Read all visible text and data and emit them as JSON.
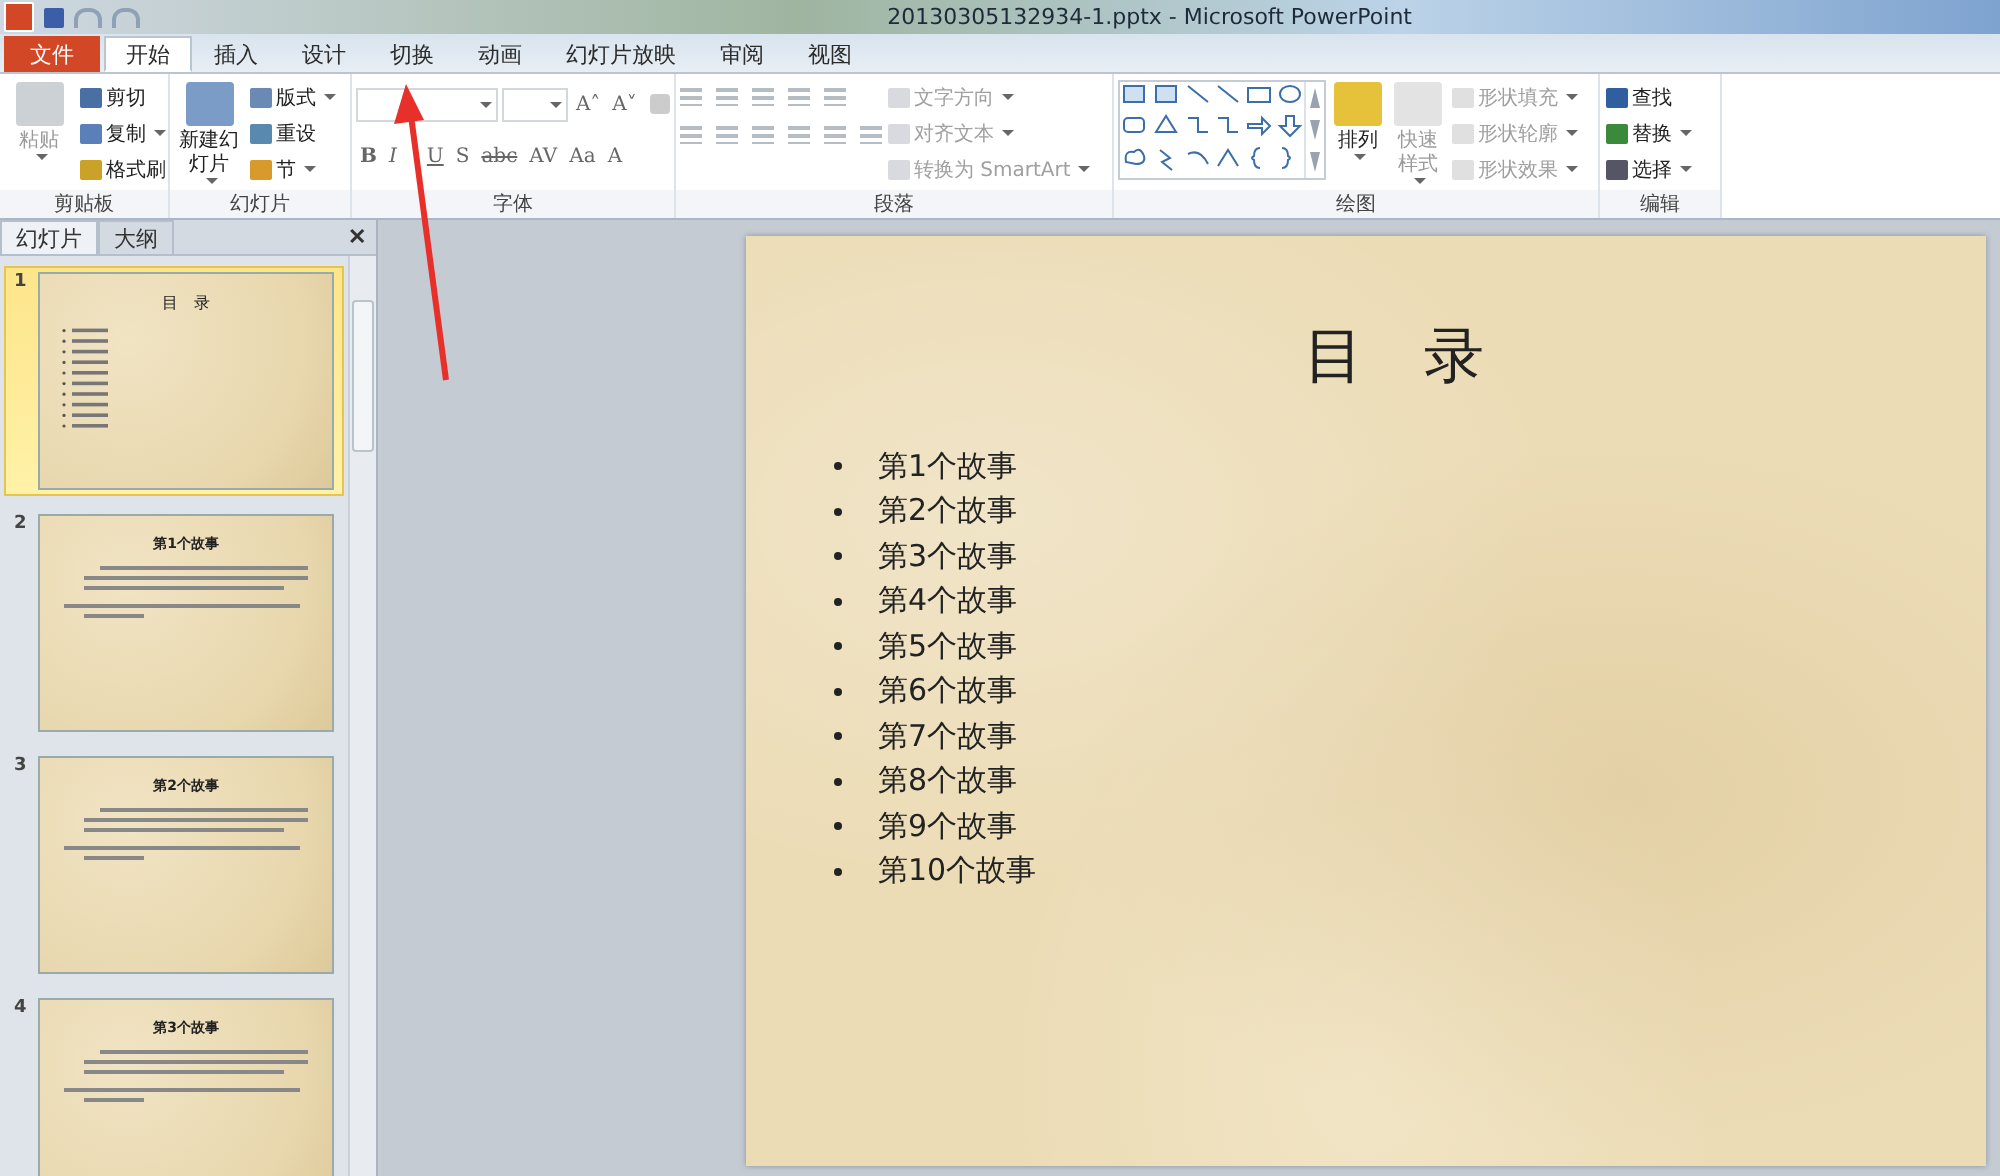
{
  "window": {
    "title": "20130305132934-1.pptx - Microsoft PowerPoint"
  },
  "tabs": [
    {
      "label": "文件",
      "kind": "file",
      "selected": false
    },
    {
      "label": "开始",
      "kind": "tab",
      "selected": true
    },
    {
      "label": "插入",
      "kind": "tab",
      "selected": false
    },
    {
      "label": "设计",
      "kind": "tab",
      "selected": false
    },
    {
      "label": "切换",
      "kind": "tab",
      "selected": false
    },
    {
      "label": "动画",
      "kind": "tab",
      "selected": false
    },
    {
      "label": "幻灯片放映",
      "kind": "tab",
      "selected": false
    },
    {
      "label": "审阅",
      "kind": "tab",
      "selected": false
    },
    {
      "label": "视图",
      "kind": "tab",
      "selected": false
    }
  ],
  "ribbon": [
    {
      "name": "剪贴板",
      "kind": "buttons",
      "items": [
        {
          "label": "粘贴",
          "kind": "large",
          "disabled": true,
          "dropdown": true
        },
        {
          "label": "剪切",
          "kind": "small",
          "disabled": false,
          "dropdown": false
        },
        {
          "label": "复制",
          "kind": "small",
          "disabled": false,
          "dropdown": true
        },
        {
          "label": "格式刷",
          "kind": "small",
          "disabled": false,
          "dropdown": false
        }
      ]
    },
    {
      "name": "幻灯片",
      "kind": "buttons",
      "items": [
        {
          "label": "新建幻灯片",
          "kind": "large",
          "disabled": false,
          "dropdown": true
        },
        {
          "label": "版式",
          "kind": "small",
          "disabled": false,
          "dropdown": true
        },
        {
          "label": "重设",
          "kind": "small",
          "disabled": false,
          "dropdown": false
        },
        {
          "label": "节",
          "kind": "small",
          "disabled": false,
          "dropdown": true
        }
      ]
    },
    {
      "name": "字体",
      "kind": "font",
      "glyphs": [
        "B",
        "I",
        "U",
        "S",
        "abc",
        "AV",
        "Aa",
        "A"
      ],
      "size_glyphs": [
        "A˄",
        "A˅"
      ]
    },
    {
      "name": "段落",
      "kind": "paragraph",
      "items": [
        {
          "label": "文字方向",
          "kind": "small",
          "disabled": true,
          "dropdown": true
        },
        {
          "label": "对齐文本",
          "kind": "small",
          "disabled": true,
          "dropdown": true
        },
        {
          "label": "转换为 SmartArt",
          "kind": "small",
          "disabled": true,
          "dropdown": true
        }
      ]
    },
    {
      "name": "绘图",
      "kind": "drawing",
      "items": [
        {
          "label": "排列",
          "kind": "large",
          "disabled": false,
          "dropdown": true
        },
        {
          "label": "快速样式",
          "kind": "large",
          "disabled": true,
          "dropdown": true
        },
        {
          "label": "形状填充",
          "kind": "small",
          "disabled": true,
          "dropdown": true
        },
        {
          "label": "形状轮廓",
          "kind": "small",
          "disabled": true,
          "dropdown": true
        },
        {
          "label": "形状效果",
          "kind": "small",
          "disabled": true,
          "dropdown": true
        }
      ]
    },
    {
      "name": "编辑",
      "kind": "buttons",
      "items": [
        {
          "label": "查找",
          "kind": "small",
          "disabled": false,
          "dropdown": false
        },
        {
          "label": "替换",
          "kind": "small",
          "disabled": false,
          "dropdown": true
        },
        {
          "label": "选择",
          "kind": "small",
          "disabled": false,
          "dropdown": true
        }
      ]
    }
  ],
  "panel": {
    "tabs": [
      {
        "label": "幻灯片",
        "selected": true
      },
      {
        "label": "大纲",
        "selected": false
      }
    ],
    "close": "✕",
    "slides": [
      {
        "number": "1",
        "title": "目　录",
        "kind": "list",
        "selected": true
      },
      {
        "number": "2",
        "title": "第1个故事",
        "kind": "story",
        "selected": false
      },
      {
        "number": "3",
        "title": "第2个故事",
        "kind": "story",
        "selected": false
      },
      {
        "number": "4",
        "title": "第3个故事",
        "kind": "story",
        "selected": false
      }
    ]
  },
  "slide": {
    "title": "目　录",
    "bullets": [
      "第1个故事",
      "第2个故事",
      "第3个故事",
      "第4个故事",
      "第5个故事",
      "第6个故事",
      "第7个故事",
      "第8个故事",
      "第9个故事",
      "第10个故事"
    ]
  }
}
